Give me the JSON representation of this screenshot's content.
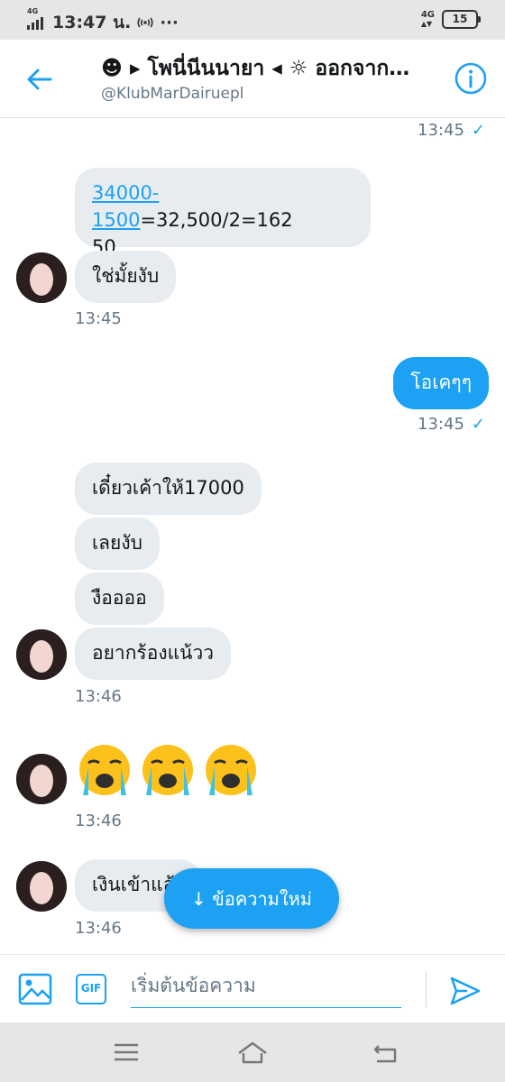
{
  "status_bar": {
    "network_left": "4G",
    "time": "13:47 น.",
    "hotspot_icon": "hotspot-icon",
    "more": "···",
    "network_right": "4G",
    "battery": "15"
  },
  "header": {
    "title": "☻ ▸ โพนี่นีนนายา ◂ ☼ ออกจาก…",
    "handle": "@KlubMarDairuepl"
  },
  "messages": {
    "t1": "13:45",
    "calc_link": "34000-1500",
    "calc_rest_1": "=32,500/2=162",
    "calc_rest_2": "50",
    "m_chai": "ใช่มั้ยงับ",
    "t2": "13:45",
    "out_ok": "โอเคๆๆ",
    "t3": "13:45",
    "m_wait": "เดี๋ยวเค้าให้17000",
    "m_loei": "เลยงับ",
    "m_ngue": "งืออออ",
    "m_cry": "อยากร้องแน้วว",
    "t4": "13:46",
    "emoji_name": "loudly-crying-face",
    "t5": "13:46",
    "m_money": "เงินเข้าแล้ว",
    "t6": "13:46"
  },
  "new_messages_button": "↓ ข้อความใหม่",
  "composer": {
    "gif_label": "GIF",
    "placeholder": "เริ่มต้นข้อความ"
  },
  "colors": {
    "accent": "#1da1f2",
    "bubble_in": "#e6ecf0",
    "meta_text": "#657786"
  }
}
